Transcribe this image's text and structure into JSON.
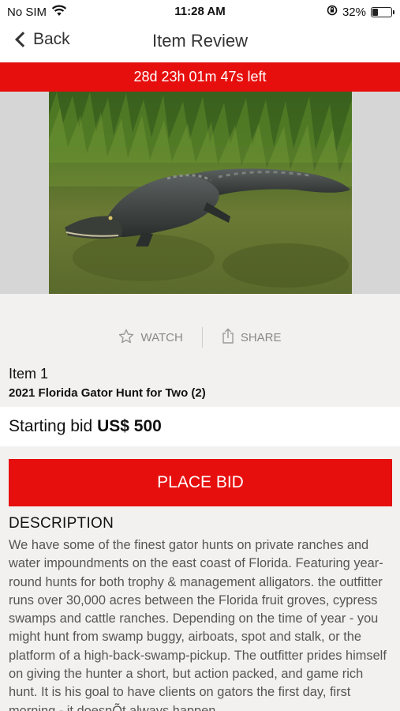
{
  "status_bar": {
    "carrier": "No SIM",
    "time": "11:28 AM",
    "battery_percent": "32%",
    "battery_level": 0.32
  },
  "nav": {
    "back_label": "Back",
    "title": "Item Review"
  },
  "timer": {
    "text": "28d 23h 01m 47s left"
  },
  "actions": {
    "watch_label": "WATCH",
    "share_label": "SHARE"
  },
  "item": {
    "number_label": "Item 1",
    "title": "2021 Florida Gator Hunt for Two (2)"
  },
  "bid": {
    "label": "Starting bid",
    "amount": "US$ 500",
    "button_label": "PLACE BID"
  },
  "description": {
    "heading": "DESCRIPTION",
    "body": "We have some of the finest gator hunts on private ranches and water impoundments on the east coast of Florida. Featuring year-round hunts for both trophy & management alligators. the outfitter runs over 30,000 acres between the Florida fruit groves, cypress swamps and cattle ranches. Depending on the time of year - you might hunt from swamp buggy, airboats, spot and stalk, or the platform of a high-back-swamp-pickup. The outfitter prides himself on giving the hunter a short, but action packed, and game rich hunt. It is his goal to have clients on gators the first day, first morning - it doesnÕt always happen"
  },
  "icons": {
    "wifi": "wifi-icon",
    "lock_rotation": "orientation-lock-icon",
    "battery": "battery-icon",
    "back": "chevron-left-icon",
    "watch": "star-outline-icon",
    "share": "share-icon"
  },
  "colors": {
    "accent": "#e60f0d",
    "background": "#f2f1ef"
  }
}
